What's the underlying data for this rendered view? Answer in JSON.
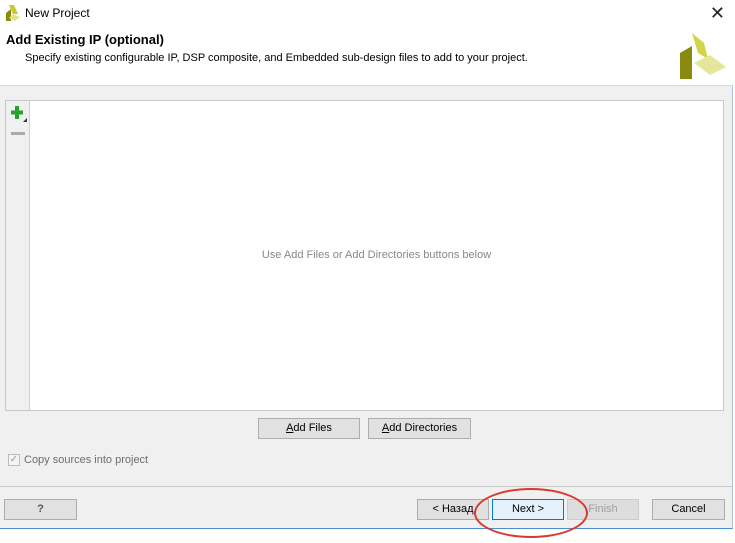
{
  "window": {
    "title": "New Project",
    "icon": "xilinx-logo-icon"
  },
  "header": {
    "title": "Add Existing IP (optional)",
    "subtitle": "Specify existing configurable IP, DSP composite, and Embedded sub-design files to add to your project."
  },
  "panel": {
    "empty_message": "Use Add Files or Add Directories buttons below",
    "tools": [
      "add-icon",
      "remove-icon"
    ]
  },
  "buttons": {
    "add_files": "Add Files",
    "add_directories": "Add Directories",
    "help": "?",
    "back": "< Назад",
    "next": "Next >",
    "finish": "Finish",
    "cancel": "Cancel"
  },
  "copy_sources": {
    "label": "Copy sources into project",
    "checked": true,
    "enabled": false
  },
  "colors": {
    "highlight_ring": "#d83a2e",
    "accent": "#0078d7",
    "plus": "#2ca02c"
  }
}
